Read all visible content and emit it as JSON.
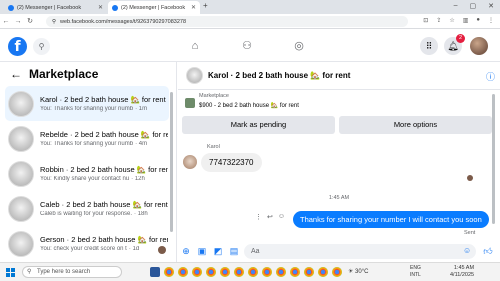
{
  "browser": {
    "tabs": [
      {
        "label": "(2) Messenger | Facebook",
        "active": false
      },
      {
        "label": "(2) Messenger | Facebook",
        "active": true
      }
    ],
    "url": "web.facebook.com/messages/t/9263790297083278",
    "new_tab": "+",
    "window_controls": [
      "–",
      "▢",
      "✕"
    ]
  },
  "fb": {
    "logo": "f",
    "notifications_count": "2",
    "icons": [
      "home-icon",
      "friends-icon",
      "groups-icon",
      "menu-grid-icon",
      "messenger-icon",
      "bell-icon"
    ]
  },
  "sidebar": {
    "title": "Marketplace",
    "conversations": [
      {
        "name": "Karol · 2 bed 2 bath house 🏡 for rent",
        "preview": "You: Thanks for sharing your numb",
        "time": "· 1m",
        "active": true
      },
      {
        "name": "Rebelde · 2 bed 2 bath house 🏡 for rent",
        "preview": "You: Thanks for sharing your numb",
        "time": "· 4m",
        "active": false
      },
      {
        "name": "Robbin · 2 bed 2 bath house 🏡 for rent",
        "preview": "You: Kindly share your contact nu",
        "time": "· 12h",
        "active": false
      },
      {
        "name": "Caleb · 2 bed 2 bath house 🏡 for rent",
        "preview": "Caleb is waiting for your response.",
        "time": "· 18h",
        "active": false
      },
      {
        "name": "Gerson · 2 bed 2 bath house 🏡 for rent",
        "preview": "You: check your credit score on t",
        "time": "· 1d",
        "active": false
      }
    ]
  },
  "chat": {
    "title": "Karol · 2 bed 2 bath house 🏡 for rent",
    "marketplace_label": "Marketplace",
    "listing": "$900 - 2 bed 2 bath house 🏡 for rent",
    "mark_pending": "Mark as pending",
    "more_options": "More options",
    "sender": "Karol",
    "incoming": "7747322370",
    "timestamp": "1:45 AM",
    "outgoing": "Thanks for sharing your number I will contact you soon",
    "status": "Sent",
    "composer_placeholder": "Aa"
  },
  "taskbar": {
    "search_placeholder": "Type here to search",
    "weather": "30°C",
    "lang_1": "ENG",
    "lang_2": "INTL",
    "time": "1:45 AM",
    "date": "4/11/2025"
  },
  "colors": {
    "brand": "#1877f2",
    "outgoing_bubble": "#0a7cff",
    "active_conversation": "#ebf5ff"
  }
}
